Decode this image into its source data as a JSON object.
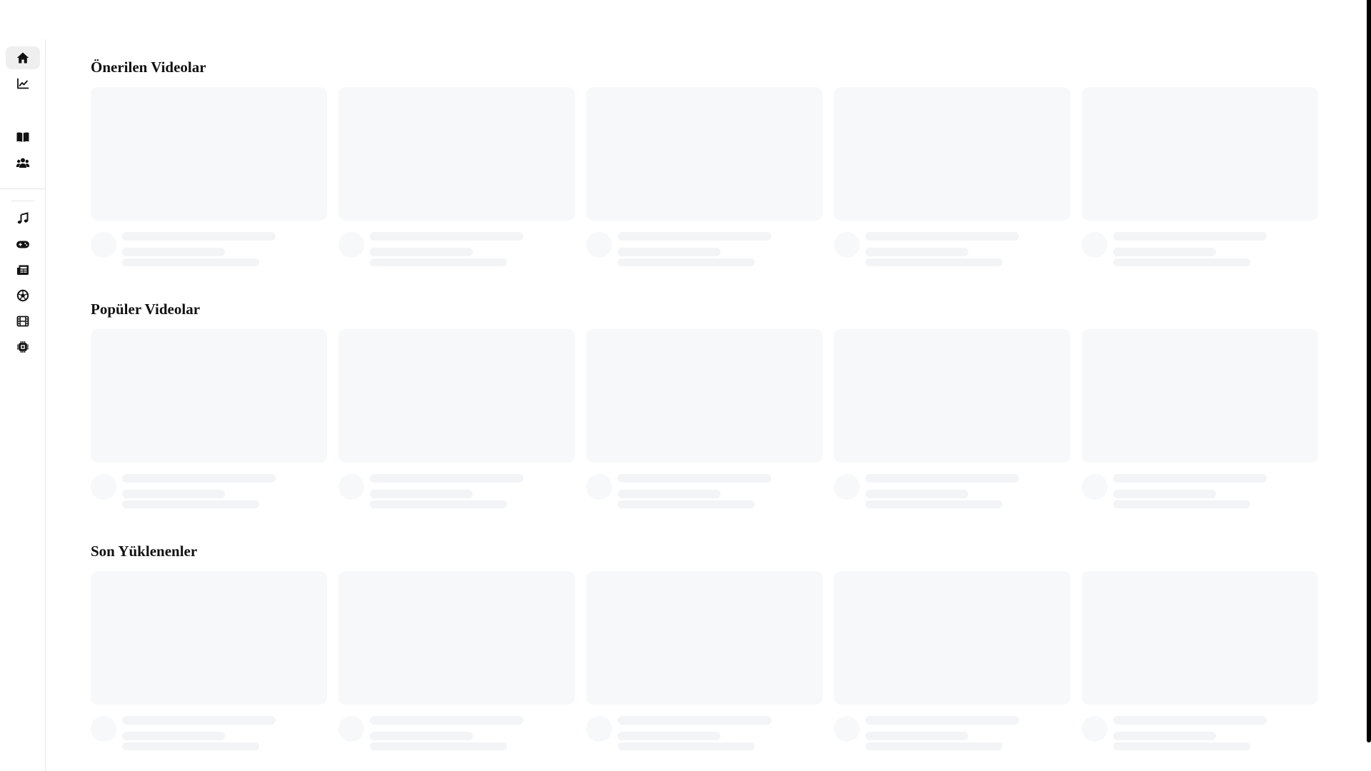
{
  "sidebar": {
    "items": [
      {
        "icon": "home-icon",
        "label": "Home",
        "active": true
      },
      {
        "icon": "trending-icon",
        "label": "Trending",
        "active": false
      },
      {
        "icon": "book-icon",
        "label": "Library",
        "active": false
      },
      {
        "icon": "users-icon",
        "label": "Subscriptions",
        "active": false
      },
      {
        "icon": "music-icon",
        "label": "Music",
        "active": false
      },
      {
        "icon": "gamepad-icon",
        "label": "Gaming",
        "active": false
      },
      {
        "icon": "news-icon",
        "label": "News",
        "active": false
      },
      {
        "icon": "soccer-ball-icon",
        "label": "Sports",
        "active": false
      },
      {
        "icon": "film-icon",
        "label": "Movies",
        "active": false
      },
      {
        "icon": "cpu-chip-icon",
        "label": "Technology",
        "active": false
      }
    ]
  },
  "sections": [
    {
      "title": "Önerilen Videolar",
      "card_count": 5,
      "loading": true
    },
    {
      "title": "Popüler Videolar",
      "card_count": 5,
      "loading": true
    },
    {
      "title": "Son Yüklenenler",
      "card_count": 5,
      "loading": true
    }
  ],
  "colors": {
    "skeleton_thumb": "#f7f8f9",
    "skeleton_line": "#f3f4f6",
    "active_item_bg": "#efefef",
    "title_text": "#111111"
  }
}
